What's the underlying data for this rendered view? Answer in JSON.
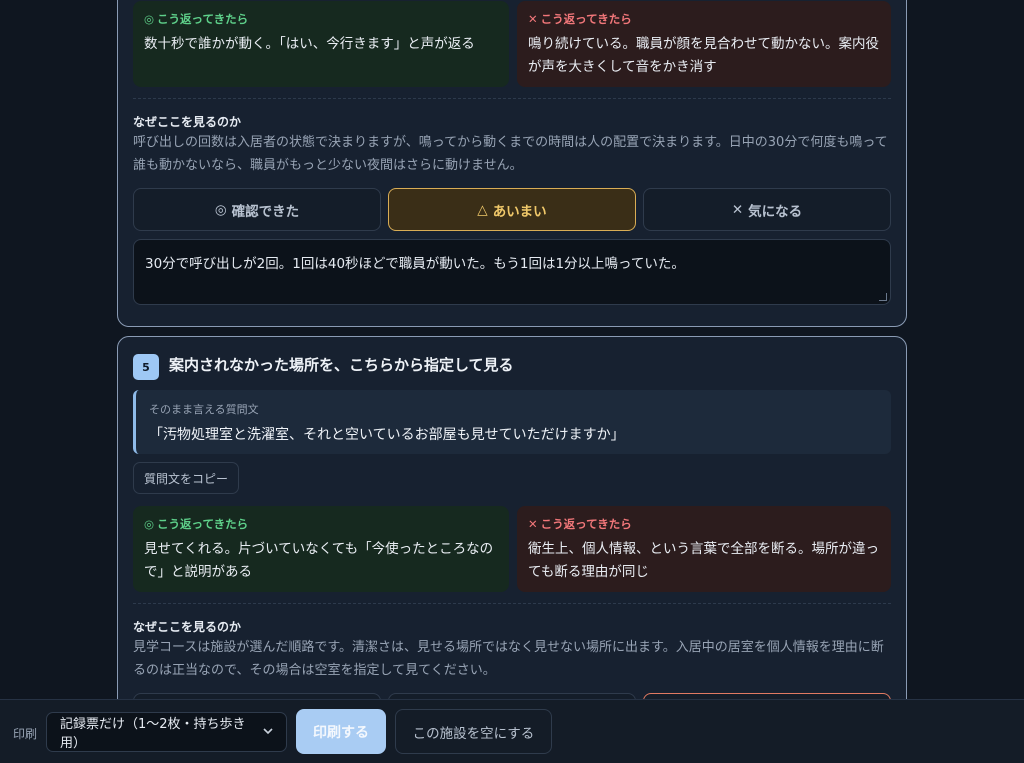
{
  "card4": {
    "good": {
      "label": "こう返ってきたら",
      "icon": "◎",
      "text": "数十秒で誰かが動く。「はい、今行きます」と声が返る"
    },
    "bad": {
      "label": "こう返ってきたら",
      "icon": "✕",
      "text": "鳴り続けている。職員が顔を見合わせて動かない。案内役が声を大きくして音をかき消す"
    },
    "why_title": "なぜここを見るのか",
    "why_text": "呼び出しの回数は入居者の状態で決まりますが、鳴ってから動くまでの時間は人の配置で決まります。日中の30分で何度も鳴って誰も動かないなら、職員がもっと少ない夜間はさらに動けません。",
    "buttons": [
      {
        "icon": "◎",
        "label": "確認できた"
      },
      {
        "icon": "△",
        "label": "あいまい"
      },
      {
        "icon": "✕",
        "label": "気になる"
      }
    ],
    "selected": "あいまい",
    "note": "30分で呼び出しが2回。1回は40秒ほどで職員が動いた。もう1回は1分以上鳴っていた。"
  },
  "card5": {
    "number": "5",
    "title": "案内されなかった場所を、こちらから指定して見る",
    "quote_label": "そのまま言える質問文",
    "quote_text": "「汚物処理室と洗濯室、それと空いているお部屋も見せていただけますか」",
    "copy_label": "質問文をコピー",
    "good": {
      "label": "こう返ってきたら",
      "icon": "◎",
      "text": "見せてくれる。片づいていなくても「今使ったところなので」と説明がある"
    },
    "bad": {
      "label": "こう返ってきたら",
      "icon": "✕",
      "text": "衛生上、個人情報、という言葉で全部を断る。場所が違っても断る理由が同じ"
    },
    "why_title": "なぜここを見るのか",
    "why_text": "見学コースは施設が選んだ順路です。清潔さは、見せる場所ではなく見せない場所に出ます。入居中の居室を個人情報を理由に断るのは正当なので、その場合は空室を指定して見てください。"
  },
  "bottom": {
    "print_label": "印刷",
    "select_value": "記録票だけ（1〜2枚・持ち歩き用）",
    "print_button": "印刷する",
    "clear_button": "この施設を空にする"
  },
  "colors": {
    "good": "#5ed08a",
    "bad": "#f2777a",
    "accent": "#9ec8f5",
    "ambiguous": "#f1c96a"
  }
}
